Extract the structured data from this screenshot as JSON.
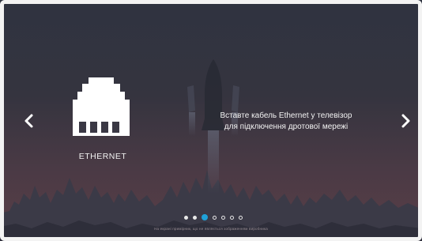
{
  "nav": {
    "prev_icon": "chevron-left-icon",
    "next_icon": "chevron-right-icon"
  },
  "slide": {
    "icon": "ethernet-port-icon",
    "label": "ETHERNET",
    "message_line1": "Вставте кабель Ethernet у телевізор",
    "message_line2": "для підключення дротової мережі"
  },
  "pagination": {
    "total": 7,
    "active_index": 2,
    "filled": [
      0,
      1
    ]
  },
  "footer": {
    "note": "На екрані примірник, що не являється зображенням виробника"
  },
  "colors": {
    "accent": "#1fa1d8",
    "text": "#f2f2f2",
    "frame": "#f3f3f3"
  }
}
